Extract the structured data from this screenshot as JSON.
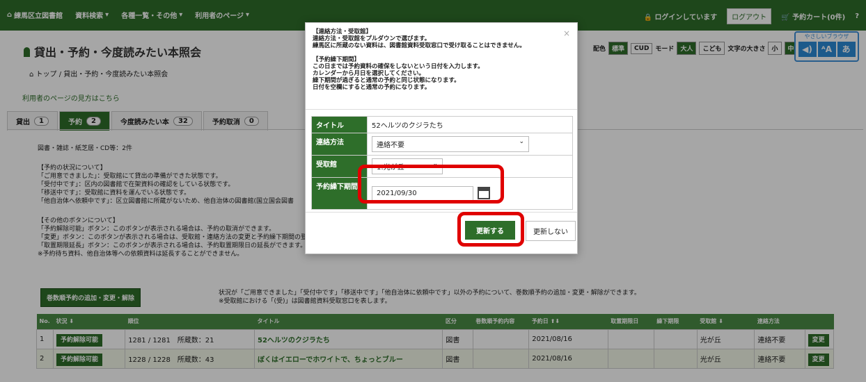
{
  "topbar": {
    "home": "練馬区立図書館",
    "menu1": "資料検索",
    "menu2": "各種一覧・その他",
    "menu3": "利用者のページ",
    "login_status": "ログインしています",
    "logout": "ログアウト",
    "cart": "予約カート(0件)",
    "help": "?"
  },
  "page": {
    "title": "貸出・予約・今度読みたい本照会",
    "breadcrumb_top": "トップ",
    "breadcrumb_current": "貸出・予約・今度読みたい本照会",
    "guide_link": "利用者のページの見方はこちら"
  },
  "display_opts": {
    "haishoku": "配色",
    "std": "標準",
    "cud": "CUD",
    "mode": "モード",
    "adult": "大人",
    "child": "こども",
    "fontsize": "文字の大きさ",
    "small": "小",
    "mid": "中",
    "large": "大"
  },
  "browser": {
    "caption": "やさしいブラウザ",
    "icon1": "◀)",
    "icon2": "ᴬA",
    "icon3": "あ"
  },
  "tabs": [
    {
      "label": "貸出",
      "count": "1"
    },
    {
      "label": "予約",
      "count": "2"
    },
    {
      "label": "今度読みたい本",
      "count": "32"
    },
    {
      "label": "予約取消",
      "count": "0"
    }
  ],
  "content": {
    "media_count": "図書・雑誌・紙芝居・CD等：2件",
    "status_heading": "【予約の状況について】",
    "status1": "「ご用意できました」：受取館にて貸出の準備ができた状態です。",
    "status2": "「受付中です」：区内の図書館で在架資料の確認をしている状態です。",
    "status3": "「移送中です」：受取館に資料を運んでいる状態です。",
    "status4": "「他自治体へ依頼中です」：区立図書館に所蔵がないため、他自治体の図書館(国立国会図書",
    "other_heading": "【その他のボタンについて】",
    "other1": "「予約解除可能」ボタン：このボタンが表示される場合は、予約の取消ができます。",
    "other2": "「変更」ボタン：このボタンが表示される場合は、受取館・連絡方法の変更と予約繰下期間の登",
    "other3": "「取置期限延長」ボタン：このボタンが表示される場合は、予約取置期限日の延長ができます。",
    "other4": "※予約待ち資料、他自治体等への依頼資料は延長することができません。",
    "add_button": "巻数順予約の追加・変更・解除",
    "note1": "状況が「ご用意できました」「受付中です」「移送中です」「他自治体に依頼中です」以外の予約について、巻数順予約の追加・変更・解除ができます。",
    "note2": "※受取館における「(受)」は図書館資料受取窓口を表します。"
  },
  "table": {
    "headers": [
      "No.",
      "状況",
      "順位",
      "タイトル",
      "区分",
      "巻数順予約内容",
      "予約日",
      "取置期限日",
      "繰下期限",
      "受取館",
      "連絡方法",
      ""
    ],
    "rows": [
      {
        "no": "1",
        "status": "予約解除可能",
        "rank": "1281 / 1281　所蔵数：21",
        "title": "52ヘルツのクジラたち",
        "kubun": "図書",
        "date": "2021/08/16",
        "branch": "光が丘",
        "contact": "連絡不要",
        "change": "変更"
      },
      {
        "no": "2",
        "status": "予約解除可能",
        "rank": "1228 / 1228　所蔵数：43",
        "title": "ぼくはイエローでホワイトで、ちょっとブルー",
        "kubun": "図書",
        "date": "2021/08/16",
        "branch": "光が丘",
        "contact": "連絡不要",
        "change": "変更"
      }
    ]
  },
  "modal": {
    "help_text": "【連絡方法・受取館】\n連絡方法・受取館をプルダウンで選びます。\n練馬区に所蔵のない資料は、図書館資料受取窓口で受け取ることはできません。\n\n【予約繰下期間】\nこの日までは予約資料の確保をしないという日付を入力します。\nカレンダーから月日を選択してください。\n繰下期間が過ぎると通常の予約と同じ状態になります。\n日付を空欄にすると通常の予約になります。",
    "close": "×",
    "title_label": "タイトル",
    "title_value": "52ヘルツのクジラたち",
    "contact_label": "連絡方法",
    "contact_value": "連絡不要",
    "branch_label": "受取館",
    "branch_value": "1:光が丘",
    "defer_label": "予約繰下期間",
    "defer_value": "2021/09/30",
    "update": "更新する",
    "no_update": "更新しない"
  },
  "colors": {
    "brand": "#2e6e2a",
    "highlight": "#e00000"
  }
}
